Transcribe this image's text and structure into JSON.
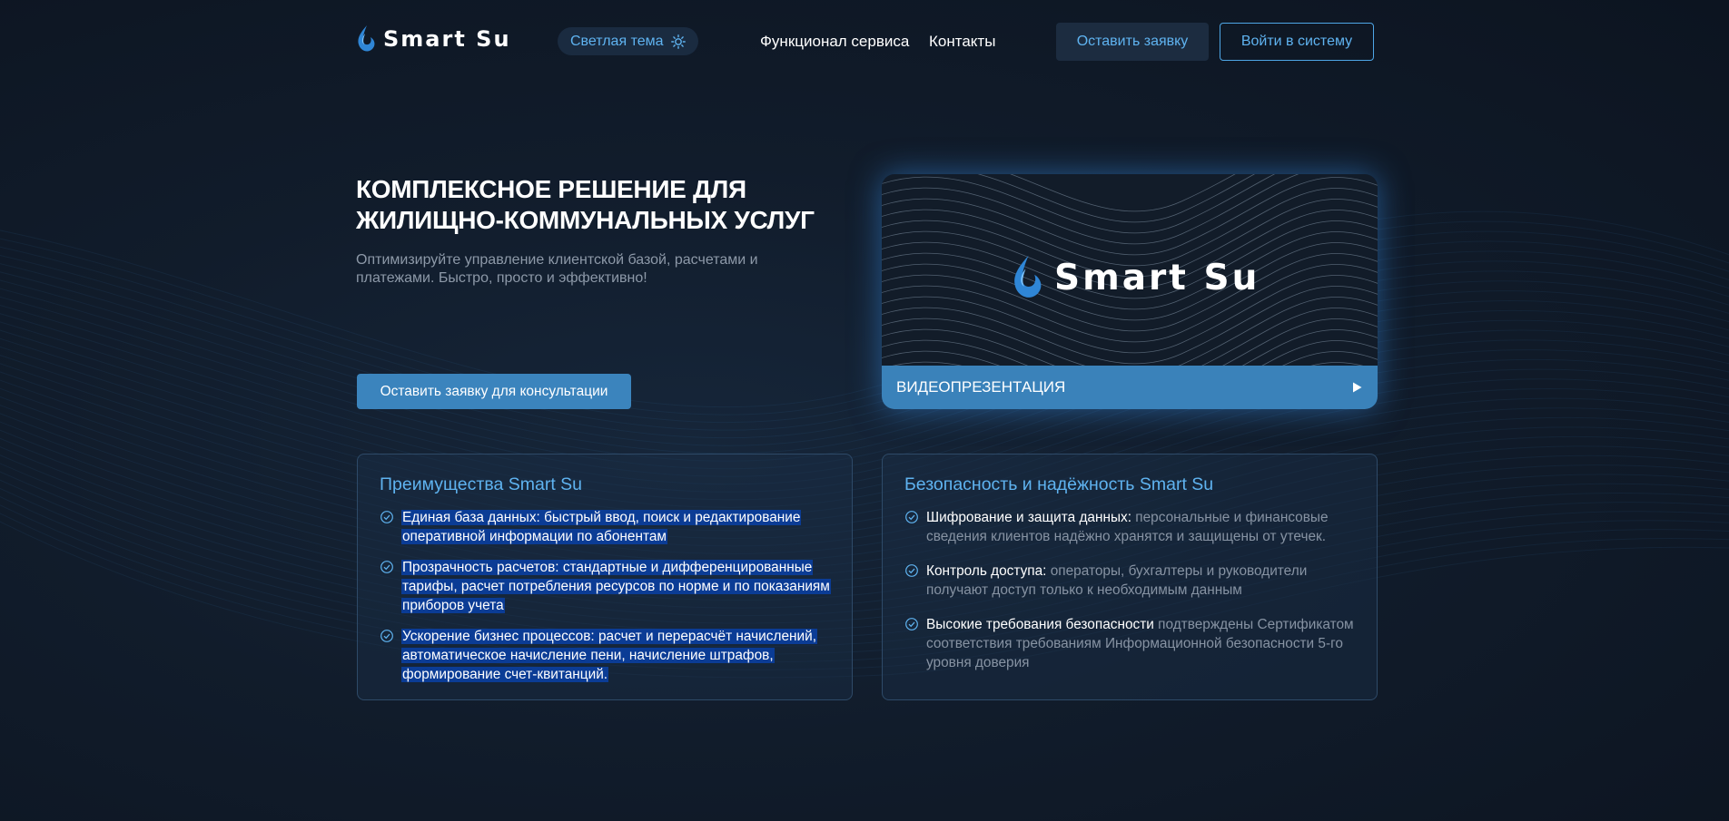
{
  "header": {
    "logo_text": "Smart Su",
    "theme_toggle_label": "Светлая тема",
    "nav": [
      {
        "label": "Функционал сервиса"
      },
      {
        "label": "Контакты"
      }
    ],
    "request_button": "Оставить заявку",
    "login_button": "Войти в систему"
  },
  "hero": {
    "title_line1": "КОМПЛЕКСНОЕ РЕШЕНИЕ ДЛЯ",
    "title_line2": "ЖИЛИЩНО-КОММУНАЛЬНЫХ УСЛУГ",
    "subtitle": "Оптимизируйте управление клиентской базой, расчетами и платежами. Быстро, просто и эффективно!",
    "consult_button": "Оставить заявку для консультации"
  },
  "video": {
    "logo_text": "Smart Su",
    "label": "ВИДЕОПРЕЗЕНТАЦИЯ"
  },
  "advantages": {
    "title": "Преимущества Smart Su",
    "items": [
      {
        "text": "Единая база данных: быстрый ввод, поиск и редактирование оперативной информации по абонентам"
      },
      {
        "text": "Прозрачность расчетов: стандартные и дифференцированные тарифы, расчет потребления ресурсов по норме и по показаниям приборов учета"
      },
      {
        "text": "Ускорение бизнес процессов: расчет и перерасчёт начислений, автоматическое начисление пени, начисление штрафов, формирование счет-квитанций."
      }
    ]
  },
  "security": {
    "title": "Безопасность и надёжность Smart Su",
    "items": [
      {
        "strong": "Шифрование и защита данных:",
        "rest": " персональные и финансовые сведения клиентов надёжно хранятся и защищены от утечек."
      },
      {
        "strong": "Контроль доступа:",
        "rest": " операторы, бухгалтеры и руководители получают доступ только к необходимым данным"
      },
      {
        "strong": "Высокие требования безопасности",
        "rest": " подтверждены Сертификатом соответствия требованиям Информационной безопасности 5-го уровня доверия"
      }
    ]
  },
  "colors": {
    "background": "#111c2b",
    "accent": "#5fb3f0",
    "primary_button": "#3b84bd",
    "selection_highlight": "#0b3c95"
  },
  "icons": [
    "flame-logo-icon",
    "sun-icon",
    "play-icon",
    "check-circle-icon"
  ]
}
